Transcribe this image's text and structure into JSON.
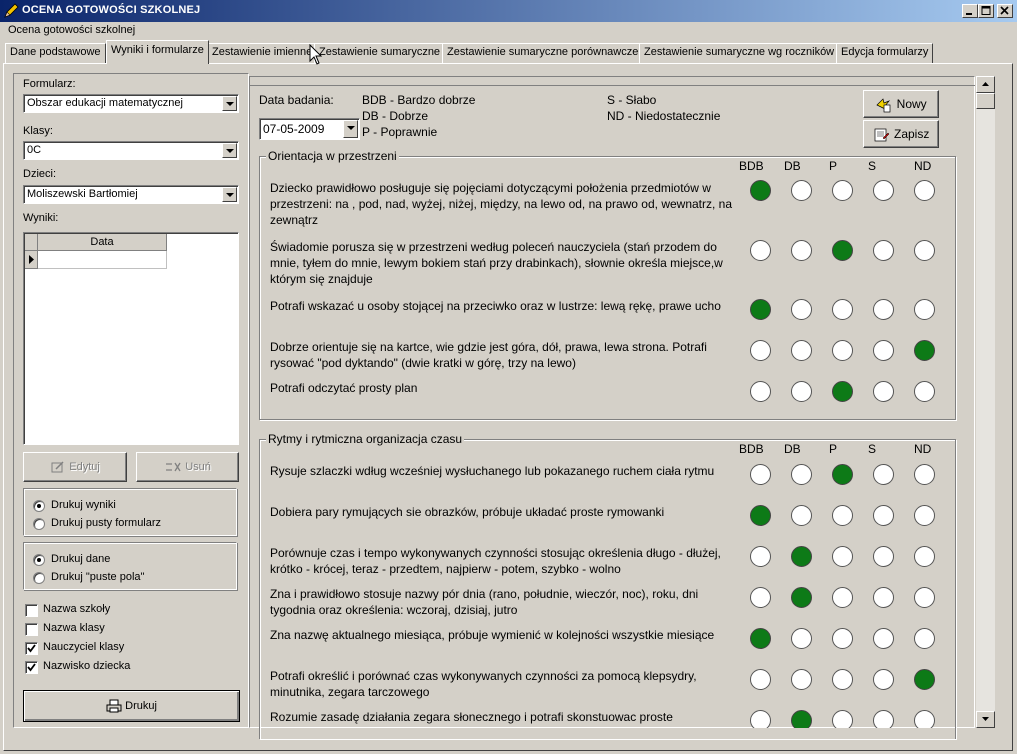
{
  "window": {
    "title": "OCENA GOTOWOŚCI SZKOLNEJ",
    "menu": "Ocena gotowości szkolnej"
  },
  "tabs": [
    {
      "label": "Dane podstawowe",
      "active": false
    },
    {
      "label": "Wyniki i formularze",
      "active": true
    },
    {
      "label": "Zestawienie imienne",
      "active": false
    },
    {
      "label": "Zestawienie sumaryczne",
      "active": false
    },
    {
      "label": "Zestawienie sumaryczne porównawcze",
      "active": false
    },
    {
      "label": "Zestawienie sumaryczne wg roczników",
      "active": false
    },
    {
      "label": "Edycja formularzy",
      "active": false
    }
  ],
  "left": {
    "formularz_label": "Formularz:",
    "formularz_value": "Obszar edukacji matematycznej",
    "klasy_label": "Klasy:",
    "klasy_value": "0C",
    "dzieci_label": "Dzieci:",
    "dzieci_value": "Moliszewski Bartłomiej",
    "wyniki_label": "Wyniki:",
    "grid_header": "Data",
    "edytuj": "Edytuj",
    "usun": "Usuń",
    "radio1": [
      {
        "label": "Drukuj wyniki",
        "checked": true
      },
      {
        "label": "Drukuj pusty formularz",
        "checked": false
      }
    ],
    "radio2": [
      {
        "label": "Drukuj dane",
        "checked": true
      },
      {
        "label": "Drukuj \"puste pola\"",
        "checked": false
      }
    ],
    "checks": [
      {
        "label": "Nazwa szkoły",
        "checked": false
      },
      {
        "label": "Nazwa klasy",
        "checked": false
      },
      {
        "label": "Nauczyciel klasy",
        "checked": true
      },
      {
        "label": "Nazwisko dziecka",
        "checked": true
      }
    ],
    "drukuj": "Drukuj"
  },
  "header": {
    "data_badania_label": "Data badania:",
    "date_value": "07-05-2009",
    "legend_bdb": "BDB - Bardzo dobrze",
    "legend_db": "DB - Dobrze",
    "legend_p": "P - Poprawnie",
    "legend_s": "S - Słabo",
    "legend_nd": "ND - Niedostatecznie",
    "nowy": "Nowy",
    "zapisz": "Zapisz"
  },
  "columns": [
    "BDB",
    "DB",
    "P",
    "S",
    "ND"
  ],
  "sections": [
    {
      "title": "Orientacja w przestrzeni",
      "items": [
        {
          "text": "Dziecko prawidłowo posługuje się pojęciami dotyczącymi położenia przedmiotów w przestrzeni: na , pod, nad, wyżej, niżej, między, na lewo od, na prawo od, wewnatrz, na zewnątrz",
          "rating": 0
        },
        {
          "text": "Świadomie porusza się w przestrzeni według poleceń nauczyciela (stań przodem do mnie, tyłem do mnie, lewym bokiem stań przy drabinkach), słownie określa miejsce,w którym się znajduje",
          "rating": 2
        },
        {
          "text": "Potrafi wskazać u osoby stojącej na przeciwko oraz w lustrze: lewą rękę, prawe ucho",
          "rating": 0
        },
        {
          "text": "Dobrze orientuje się na kartce, wie gdzie jest góra, dół, prawa, lewa strona. Potrafi rysować \"pod dyktando\" (dwie kratki w górę, trzy na lewo)",
          "rating": 4
        },
        {
          "text": "Potrafi odczytać prosty plan",
          "rating": 2
        }
      ]
    },
    {
      "title": "Rytmy i rytmiczna organizacja czasu",
      "items": [
        {
          "text": "Rysuje szlaczki wdług wcześniej wysłuchanego lub pokazanego ruchem ciała rytmu",
          "rating": 2
        },
        {
          "text": "Dobiera pary rymujących sie obrazków, próbuje układać proste rymowanki",
          "rating": 0
        },
        {
          "text": "Porównuje czas i tempo wykonywanych czynności stosując określenia długo - dłużej, krótko - krócej, teraz - przedtem, najpierw - potem, szybko - wolno",
          "rating": 1
        },
        {
          "text": "Zna i prawidłowo stosuje nazwy pór dnia (rano, południe, wieczór, noc), roku, dni tygodnia oraz określenia: wczoraj, dzisiaj, jutro",
          "rating": 1
        },
        {
          "text": "Zna nazwę aktualnego miesiąca, próbuje wymienić w kolejności wszystkie miesiące",
          "rating": 0
        },
        {
          "text": "Potrafi określić i porównać czas wykonywanych czynności za pomocą klepsydry, minutnika, zegara tarczowego",
          "rating": 4
        },
        {
          "text": "Rozumie zasadę działania zegara słonecznego i potrafi skonstuowac proste",
          "rating": 1
        }
      ]
    }
  ]
}
